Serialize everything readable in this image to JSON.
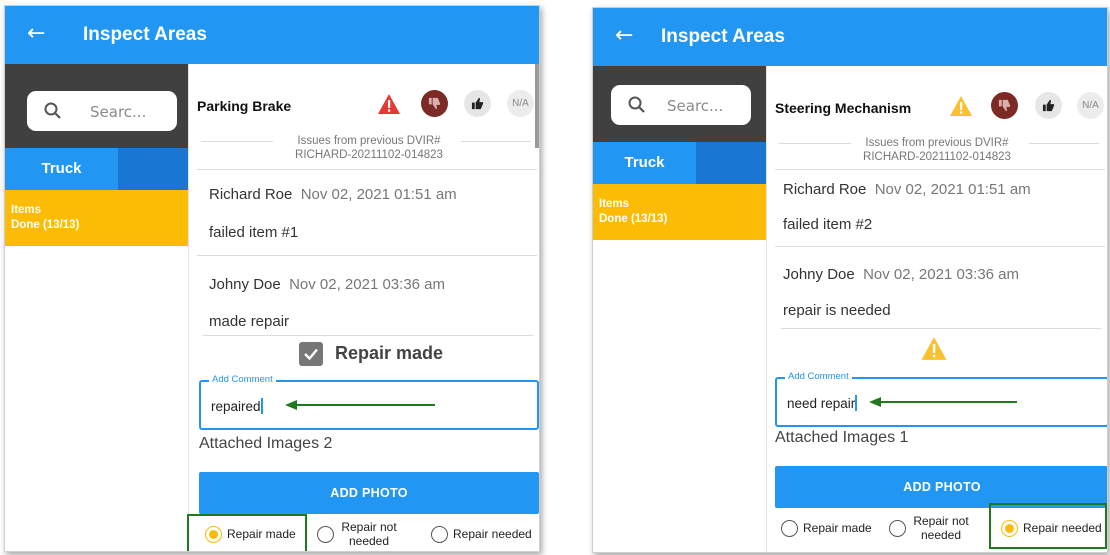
{
  "colors": {
    "appbar": "#2196f3",
    "tab_active": "#2196f3",
    "tab_inactive": "#1976d2",
    "items": "#fcbc05",
    "warning_red": "#e53935",
    "warning_yellow": "#fbc02d",
    "arrow": "#1f7a1f"
  },
  "panels": [
    {
      "app_title": "Inspect Areas",
      "back_icon": "arrow-left-icon",
      "search_placeholder": "Searc...",
      "tab": "Truck",
      "items_label": "Items",
      "items_status": "Done (13/13)",
      "item_title": "Parking Brake",
      "warning_icon": "warning-red-icon",
      "na_label": "N/A",
      "prev_issues_line1": "Issues from previous DVIR#",
      "prev_issues_line2": "RICHARD-20211102-014823",
      "comments": [
        {
          "author": "Richard Roe",
          "date": "Nov 02, 2021 01:51 am",
          "text": "failed item #1"
        },
        {
          "author": "Johny Doe",
          "date": "Nov 02, 2021 03:36 am",
          "text": "made repair"
        }
      ],
      "repair_checkbox_label": "Repair made",
      "add_comment_label": "Add Comment",
      "add_comment_value": "repaired",
      "attached_images": "Attached Images 2",
      "add_photo": "ADD PHOTO",
      "radio_options": [
        "Repair made",
        "Repair not needed",
        "Repair needed"
      ],
      "radio_selected": "Repair made"
    },
    {
      "app_title": "Inspect Areas",
      "back_icon": "arrow-left-icon",
      "search_placeholder": "Searc...",
      "tab": "Truck",
      "items_label": "Items",
      "items_status": "Done (13/13)",
      "item_title": "Steering Mechanism",
      "warning_icon": "warning-yellow-icon",
      "na_label": "N/A",
      "prev_issues_line1": "Issues from previous DVIR#",
      "prev_issues_line2": "RICHARD-20211102-014823",
      "comments": [
        {
          "author": "Richard Roe",
          "date": "Nov 02, 2021 01:51 am",
          "text": "failed item #2"
        },
        {
          "author": "Johny Doe",
          "date": "Nov 02, 2021 03:36 am",
          "text": "repair is needed"
        }
      ],
      "add_comment_label": "Add Comment",
      "add_comment_value": "need repair",
      "attached_images": "Attached Images 1",
      "add_photo": "ADD PHOTO",
      "radio_options": [
        "Repair made",
        "Repair not needed",
        "Repair needed"
      ],
      "radio_selected": "Repair needed"
    }
  ]
}
